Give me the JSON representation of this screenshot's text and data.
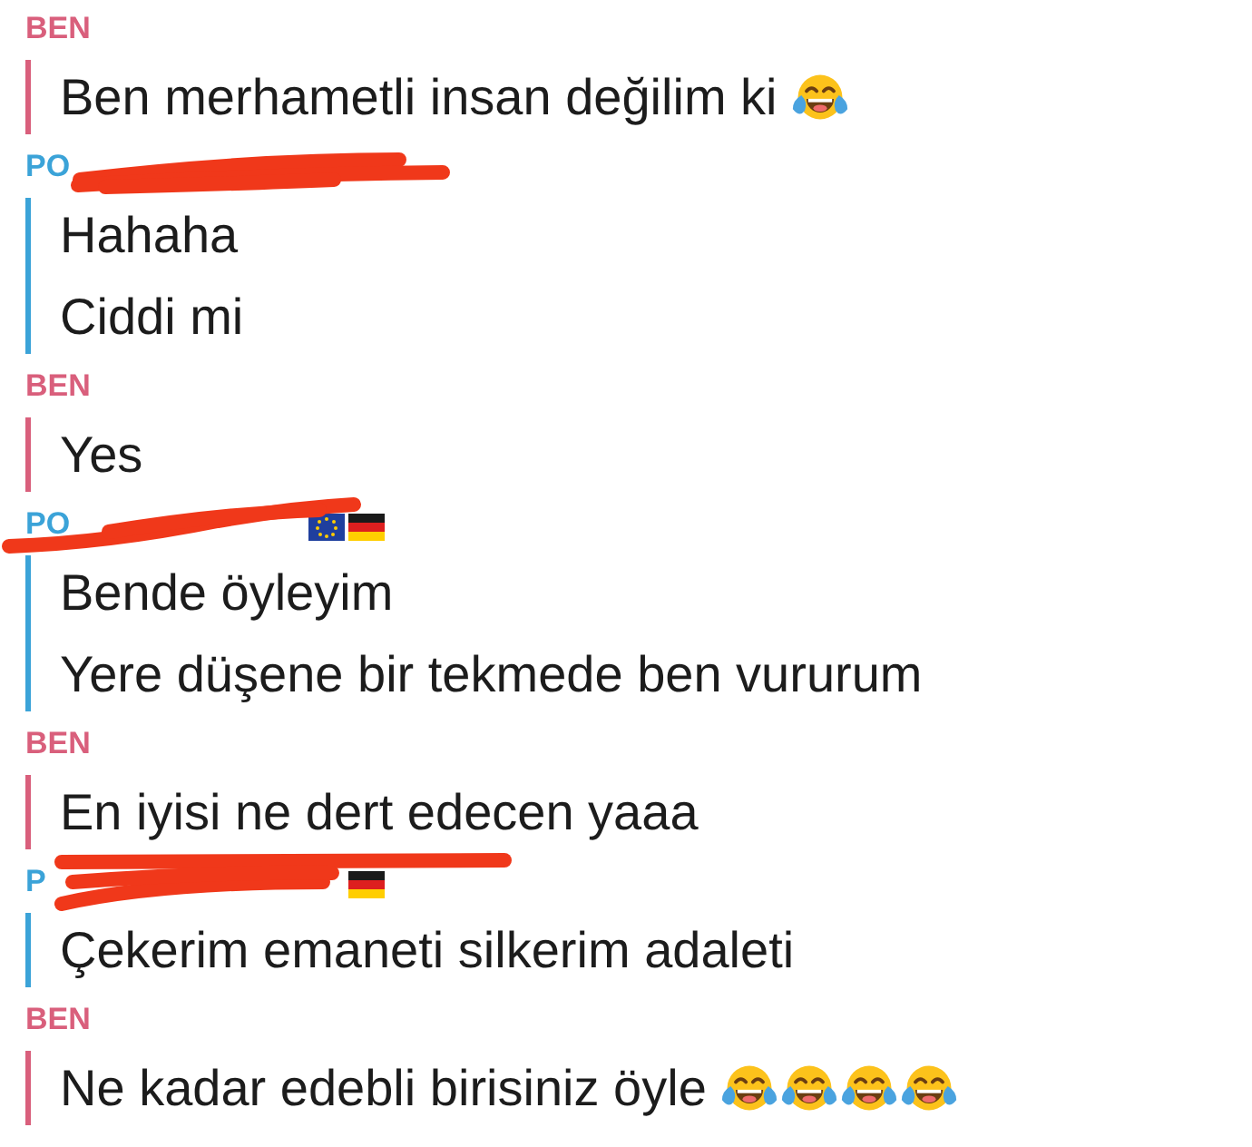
{
  "chat": {
    "groups": [
      {
        "sender": {
          "name": "BEN",
          "color": "#d95f7c",
          "redacted": false
        },
        "messages": [
          {
            "text": "Ben merhametli insan değilim ki",
            "emojis": [
              {
                "kind": "tears-of-joy"
              }
            ]
          }
        ]
      },
      {
        "sender": {
          "name": "PO",
          "color": "#3ba3d8",
          "redacted": true
        },
        "messages": [
          {
            "text": "Hahaha"
          },
          {
            "text": "Ciddi mi"
          }
        ]
      },
      {
        "sender": {
          "name": "BEN",
          "color": "#d95f7c",
          "redacted": false
        },
        "messages": [
          {
            "text": "Yes"
          }
        ]
      },
      {
        "sender": {
          "name": "PO",
          "color": "#3ba3d8",
          "redacted": true,
          "flags": [
            {
              "kind": "eu"
            },
            {
              "kind": "de"
            }
          ]
        },
        "messages": [
          {
            "text": "Bende öyleyim"
          },
          {
            "text": "Yere düşene bir tekmede ben vururum"
          }
        ]
      },
      {
        "sender": {
          "name": "BEN",
          "color": "#d95f7c",
          "redacted": false
        },
        "messages": [
          {
            "text": "En iyisi ne dert edecen yaaa"
          }
        ]
      },
      {
        "sender": {
          "name": "P",
          "color": "#3ba3d8",
          "redacted": true,
          "flags": [
            {
              "kind": "de"
            }
          ]
        },
        "messages": [
          {
            "text": "Çekerim emaneti silkerim adaleti"
          }
        ]
      },
      {
        "sender": {
          "name": "BEN",
          "color": "#d95f7c",
          "redacted": false
        },
        "messages": [
          {
            "text": "Ne kadar edebli birisiniz öyle",
            "emojis": [
              {
                "kind": "tears-of-joy"
              },
              {
                "kind": "tears-of-joy"
              },
              {
                "kind": "tears-of-joy"
              },
              {
                "kind": "tears-of-joy"
              }
            ]
          }
        ]
      }
    ]
  }
}
